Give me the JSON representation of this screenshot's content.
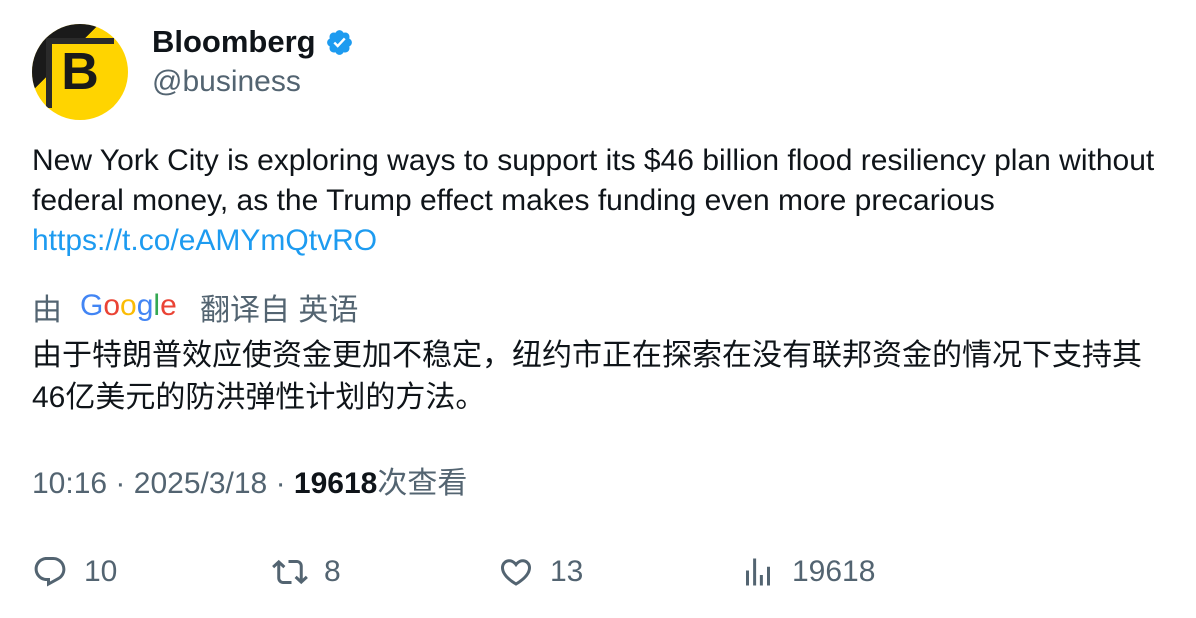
{
  "author": {
    "avatar_letter": "B",
    "name": "Bloomberg",
    "handle": "@business",
    "verified_icon": "verified-badge-icon"
  },
  "tweet": {
    "text": "New York City is exploring ways to support its $46 billion flood resiliency plan without federal money, as the Trump effect makes funding even more precarious",
    "link": "https://t.co/eAMYmQtvRO"
  },
  "translation": {
    "by_label": "由",
    "brand": "Google",
    "source_label": "翻译自 英语",
    "text": "由于特朗普效应使资金更加不稳定，纽约市正在探索在没有联邦资金的情况下支持其46亿美元的防洪弹性计划的方法。"
  },
  "meta": {
    "time": "10:16",
    "separator": "·",
    "date": "2025/3/18",
    "views": "19618",
    "views_label": "次查看"
  },
  "actions": {
    "replies": "10",
    "retweets": "8",
    "likes": "13",
    "views": "19618"
  },
  "colors": {
    "text": "#0f1419",
    "secondary": "#536471",
    "link": "#1d9bf0",
    "verified": "#1d9bf0",
    "avatar_bg": "#ffd400"
  }
}
